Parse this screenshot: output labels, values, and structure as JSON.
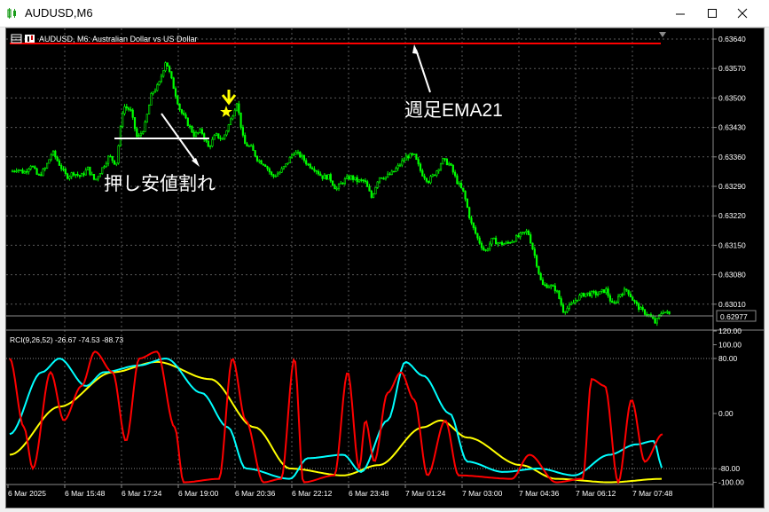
{
  "window": {
    "title": "AUDUSD,M6"
  },
  "chart": {
    "symbol_line": "AUDUSD, M6:  Australian Dollar vs US Dollar",
    "price_labels": [
      "0.63640",
      "0.63570",
      "0.63500",
      "0.63430",
      "0.63360",
      "0.63290",
      "0.63220",
      "0.63150",
      "0.63080",
      "0.63010"
    ],
    "current_price": "0.62977",
    "time_labels": [
      "6 Mar 2025",
      "6 Mar 15:48",
      "6 Mar 17:24",
      "6 Mar 19:00",
      "6 Mar 20:36",
      "6 Mar 22:12",
      "6 Mar 23:48",
      "7 Mar 01:24",
      "7 Mar 03:00",
      "7 Mar 04:36",
      "7 Mar 06:12",
      "7 Mar 07:48"
    ],
    "annotations": {
      "ema": "週足EMA21",
      "break": "押し安値割れ"
    },
    "colors": {
      "candles": "#00ff00",
      "ema_line": "#ff0000",
      "arrow": "#ffff00",
      "rci_short": "#ff0000",
      "rci_mid": "#00ffff",
      "rci_long": "#ffff00"
    }
  },
  "indicator": {
    "label": "RCI(9,26,52) -26.67 -74.53 -88.73",
    "scale_labels": [
      "120.00",
      "100.00",
      "80.00",
      "0.00",
      "-80.00",
      "-100.00"
    ]
  },
  "chart_data": {
    "type": "line",
    "title": "",
    "series": [
      {
        "name": "",
        "x": [
          0,
          8,
          16,
          24,
          32,
          40,
          48,
          56,
          64,
          72,
          80,
          88,
          96,
          104,
          112,
          120,
          128,
          136,
          144,
          152,
          160,
          168,
          176,
          184,
          192,
          200,
          208,
          216,
          224,
          232,
          240,
          248,
          256,
          264,
          272,
          280,
          288,
          296,
          304,
          312,
          320,
          328,
          336,
          344,
          352,
          360,
          368,
          376,
          384,
          392,
          400,
          408,
          416,
          424,
          432,
          440,
          448,
          456,
          464,
          472,
          480,
          488,
          496,
          504,
          512,
          520,
          528,
          536,
          544,
          552,
          560,
          568,
          576,
          584,
          592,
          600,
          608,
          616,
          624,
          632,
          640,
          648,
          656,
          664,
          672,
          680,
          688,
          696,
          704,
          712,
          720,
          728,
          736,
          744
        ],
        "values": [
          0.6332,
          0.6333,
          0.6332,
          0.6334,
          0.6331,
          0.6333,
          0.6337,
          0.6334,
          0.6331,
          0.6332,
          0.6331,
          0.6333,
          0.633,
          0.6333,
          0.6336,
          0.6334,
          0.6348,
          0.6347,
          0.634,
          0.6343,
          0.6351,
          0.6353,
          0.6359,
          0.6353,
          0.6347,
          0.6344,
          0.6341,
          0.6342,
          0.6338,
          0.6341,
          0.634,
          0.6344,
          0.6349,
          0.6339,
          0.6338,
          0.6335,
          0.6334,
          0.6331,
          0.6332,
          0.6334,
          0.6337,
          0.6336,
          0.6334,
          0.6333,
          0.6331,
          0.6331,
          0.6328,
          0.633,
          0.6331,
          0.633,
          0.633,
          0.6326,
          0.6331,
          0.6331,
          0.6332,
          0.6334,
          0.6336,
          0.6336,
          0.6332,
          0.633,
          0.6332,
          0.6335,
          0.6334,
          0.633,
          0.6327,
          0.632,
          0.6316,
          0.6313,
          0.6316,
          0.6315,
          0.6315,
          0.6316,
          0.6317,
          0.6318,
          0.6312,
          0.6305,
          0.6305,
          0.6304,
          0.6299,
          0.63,
          0.6302,
          0.6303,
          0.6303,
          0.6303,
          0.6304,
          0.63,
          0.6303,
          0.6304,
          0.6301,
          0.6299,
          0.6298,
          0.6296,
          0.6299,
          0.6298
        ]
      }
    ],
    "ylim": [
      0.62977,
      0.6364
    ],
    "grid": true
  }
}
